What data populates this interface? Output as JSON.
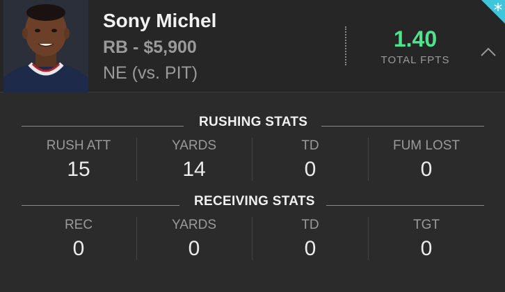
{
  "player": {
    "name": "Sony Michel",
    "position_salary": "RB - $5,900",
    "matchup": "NE (vs. PIT)"
  },
  "fpts": {
    "value": "1.40",
    "label": "TOTAL FPTS",
    "value_color": "#4ee38c"
  },
  "icons": {
    "collapse": "chevron-up-icon",
    "corner": "snowflake-icon"
  },
  "rushing": {
    "title": "RUSHING STATS",
    "stats": [
      {
        "label": "RUSH ATT",
        "value": "15"
      },
      {
        "label": "YARDS",
        "value": "14"
      },
      {
        "label": "TD",
        "value": "0"
      },
      {
        "label": "FUM LOST",
        "value": "0"
      }
    ]
  },
  "receiving": {
    "title": "RECEIVING STATS",
    "stats": [
      {
        "label": "REC",
        "value": "0"
      },
      {
        "label": "YARDS",
        "value": "0"
      },
      {
        "label": "TD",
        "value": "0"
      },
      {
        "label": "TGT",
        "value": "0"
      }
    ]
  },
  "colors": {
    "background": "#2b2b2b",
    "header": "#262626",
    "accent_green": "#4ee38c",
    "corner_badge": "#3fc6dc"
  }
}
